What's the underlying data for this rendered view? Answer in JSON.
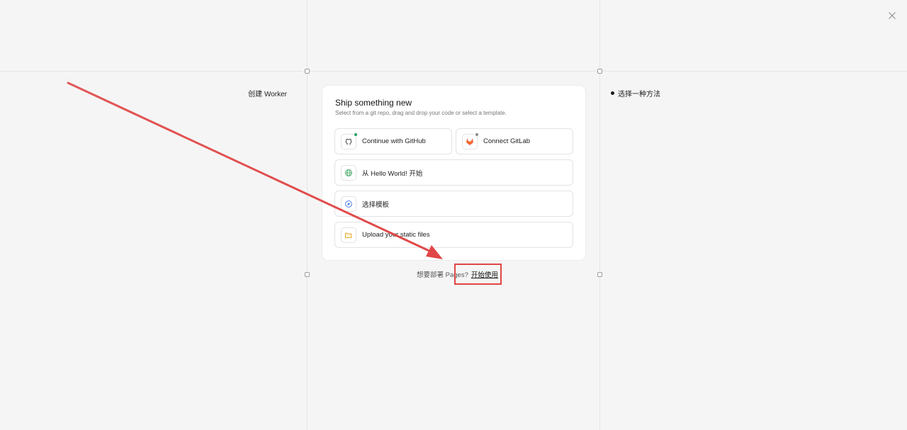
{
  "left_step": {
    "label": "创建 Worker"
  },
  "right_step": {
    "label": "选择一种方法"
  },
  "card": {
    "title": "Ship something new",
    "subtitle": "Select from a git repo, drag and drop your code or select a template."
  },
  "options": {
    "github": {
      "label": "Continue with GitHub",
      "status_color": "#22a05a",
      "icon": "github-icon"
    },
    "gitlab": {
      "label": "Connect GitLab",
      "status_color": "#8a8a8a",
      "icon": "gitlab-icon"
    },
    "hello_world": {
      "label": "从 Hello World! 开始",
      "icon": "globe-icon"
    },
    "template": {
      "label": "选择模板",
      "icon": "compass-icon"
    },
    "upload": {
      "label": "Upload your static files",
      "icon": "folder-icon"
    }
  },
  "footer": {
    "prompt": "想要部署 Pages?",
    "link": "开始使用"
  },
  "colors": {
    "annotation": "#e04646",
    "background": "#f5f5f5",
    "card": "#ffffff"
  }
}
